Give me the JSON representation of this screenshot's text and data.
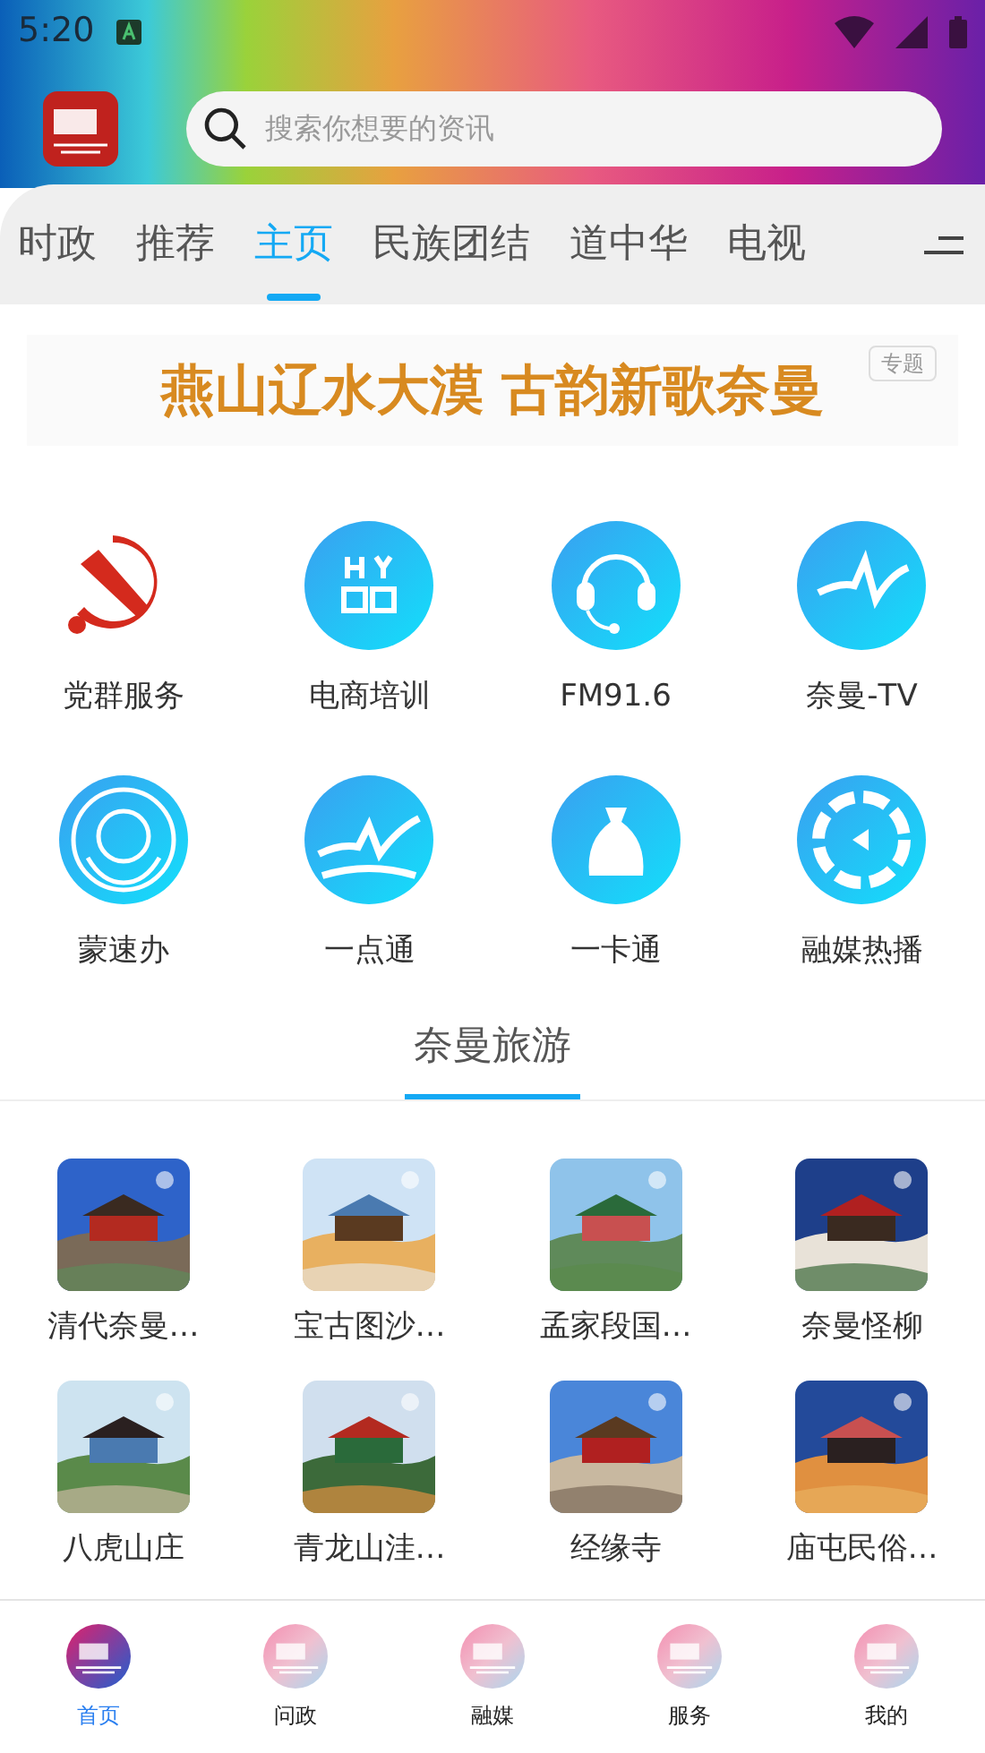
{
  "status_bar": {
    "time": "5:20"
  },
  "search": {
    "placeholder": "搜索你想要的资讯"
  },
  "tabs": [
    {
      "label": "时政",
      "selected": false
    },
    {
      "label": "推荐",
      "selected": false
    },
    {
      "label": "主页",
      "selected": true
    },
    {
      "label": "民族团结",
      "selected": false
    },
    {
      "label": "道中华",
      "selected": false
    },
    {
      "label": "电视",
      "selected": false
    }
  ],
  "banner": {
    "text": "燕山辽水大漠 古韵新歌奈曼",
    "badge": "专题"
  },
  "services": [
    {
      "label": "党群服务",
      "kind": "party"
    },
    {
      "label": "电商培训",
      "kind": "shop"
    },
    {
      "label": "FM91.6",
      "kind": "headset"
    },
    {
      "label": "奈曼-TV",
      "kind": "tv"
    },
    {
      "label": "蒙速办",
      "kind": "emblem"
    },
    {
      "label": "一点通",
      "kind": "wave"
    },
    {
      "label": "一卡通",
      "kind": "bag"
    },
    {
      "label": "融媒热播",
      "kind": "play"
    }
  ],
  "section": {
    "title": "奈曼旅游"
  },
  "tourism": [
    {
      "label": "清代奈曼…",
      "kind": "picture"
    },
    {
      "label": "宝古图沙…",
      "kind": "picture"
    },
    {
      "label": "孟家段国…",
      "kind": "picture"
    },
    {
      "label": "奈曼怪柳",
      "kind": "picture"
    },
    {
      "label": "八虎山庄",
      "kind": "picture"
    },
    {
      "label": "青龙山洼…",
      "kind": "picture"
    },
    {
      "label": "经缘寺",
      "kind": "picture"
    },
    {
      "label": "庙屯民俗…",
      "kind": "picture"
    }
  ],
  "bottom_nav": [
    {
      "label": "首页",
      "selected": true
    },
    {
      "label": "问政",
      "selected": false
    },
    {
      "label": "融媒",
      "selected": false
    },
    {
      "label": "服务",
      "selected": false
    },
    {
      "label": "我的",
      "selected": false
    }
  ]
}
